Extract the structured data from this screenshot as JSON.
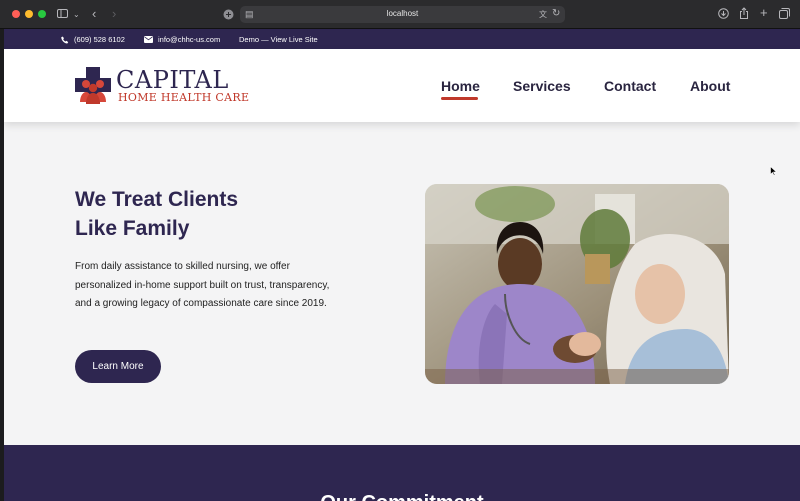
{
  "browser": {
    "url": "localhost"
  },
  "topbar": {
    "phone": "(609) 528 6102",
    "email": "info@chhc-us.com",
    "demo_link": "Demo — View Live Site"
  },
  "logo": {
    "name": "CAPITAL",
    "tagline": "HOME HEALTH CARE"
  },
  "nav": {
    "items": [
      "Home",
      "Services",
      "Contact",
      "About"
    ],
    "active": "Home"
  },
  "hero": {
    "title_line1": "We Treat Clients",
    "title_line2": "Like Family",
    "body": "From daily assistance to skilled nursing, we offer personalized in-home support built on trust, transparency, and a growing legacy of compassionate care since 2019.",
    "cta_label": "Learn More"
  },
  "section": {
    "title": "Our Commitment"
  },
  "colors": {
    "brand_purple": "#2e2650",
    "accent_red": "#c0392b"
  }
}
